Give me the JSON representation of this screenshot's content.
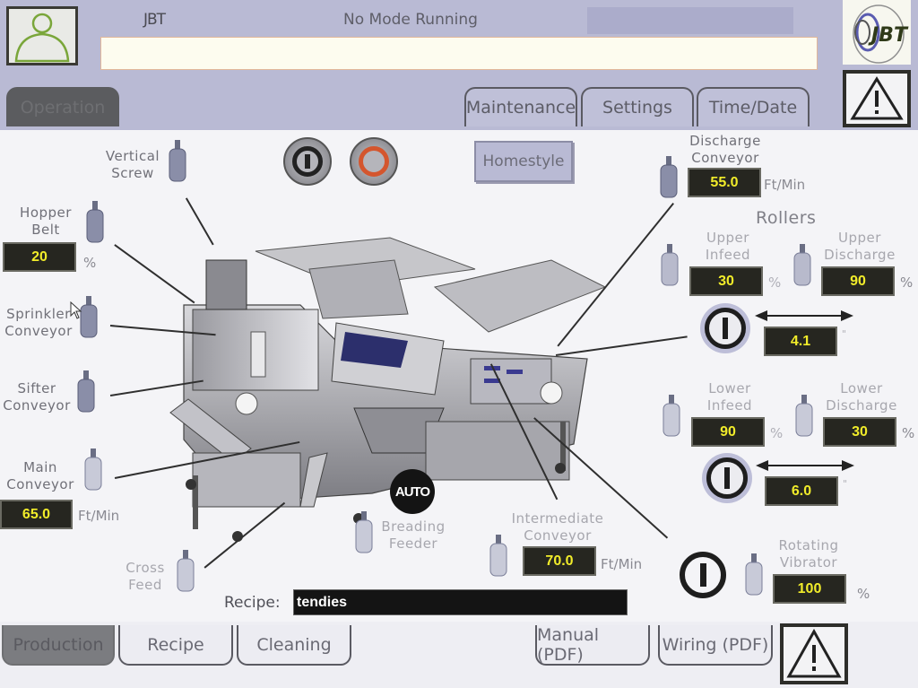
{
  "header": {
    "title": "JBT",
    "mode_status": "No Mode Running",
    "message": "",
    "logo_text": "JBT",
    "tabs": [
      {
        "label": "Operation",
        "active": true
      },
      {
        "label": "Maintenance",
        "active": false
      },
      {
        "label": "Settings",
        "active": false
      },
      {
        "label": "Time/Date",
        "active": false
      }
    ]
  },
  "controls": {
    "start_icon": "power-on-icon",
    "stop_icon": "stop-icon",
    "mode_button": "Homestyle",
    "auto_badge": "AUTO"
  },
  "components": {
    "vertical_screw": {
      "label_1": "Vertical",
      "label_2": "Screw"
    },
    "hopper_belt": {
      "label_1": "Hopper",
      "label_2": "Belt",
      "value": "20",
      "unit": "%"
    },
    "sprinkler_conveyor": {
      "label_1": "Sprinkler",
      "label_2": "Conveyor"
    },
    "sifter_conveyor": {
      "label_1": "Sifter",
      "label_2": "Conveyor"
    },
    "main_conveyor": {
      "label_1": "Main",
      "label_2": "Conveyor",
      "value": "65.0",
      "unit": "Ft/Min"
    },
    "cross_feed": {
      "label_1": "Cross",
      "label_2": "Feed"
    },
    "breading_feeder": {
      "label_1": "Breading",
      "label_2": "Feeder"
    },
    "intermediate_conveyor": {
      "label_1": "Intermediate",
      "label_2": "Conveyor",
      "value": "70.0",
      "unit": "Ft/Min"
    },
    "discharge_conveyor": {
      "label_1": "Discharge",
      "label_2": "Conveyor",
      "value": "55.0",
      "unit": "Ft/Min"
    },
    "rotating_vibrator": {
      "label_1": "Rotating",
      "label_2": "Vibrator",
      "value": "100",
      "unit": "%"
    }
  },
  "rollers": {
    "title": "Rollers",
    "upper_infeed": {
      "label_1": "Upper",
      "label_2": "Infeed",
      "value": "30",
      "unit": "%"
    },
    "upper_discharge": {
      "label_1": "Upper",
      "label_2": "Discharge",
      "value": "90",
      "unit": "%"
    },
    "upper_gap": {
      "value": "4.1",
      "unit": "\""
    },
    "lower_infeed": {
      "label_1": "Lower",
      "label_2": "Infeed",
      "value": "90",
      "unit": "%"
    },
    "lower_discharge": {
      "label_1": "Lower",
      "label_2": "Discharge",
      "value": "30",
      "unit": "%"
    },
    "lower_gap": {
      "value": "6.0",
      "unit": "\""
    }
  },
  "recipe": {
    "label": "Recipe:",
    "value": "tendies"
  },
  "footer": {
    "tabs": [
      {
        "label": "Production",
        "active": true
      },
      {
        "label": "Recipe",
        "active": false
      },
      {
        "label": "Cleaning",
        "active": false
      }
    ],
    "docs": [
      {
        "label": "Manual (PDF)"
      },
      {
        "label": "Wiring (PDF)"
      }
    ]
  },
  "colors": {
    "header_bg": "#b9bad4",
    "value_text": "#f1ec2a",
    "value_bg": "#262620",
    "active_tab": "#5b5c5f",
    "stop_ring": "#d4562e",
    "user_icon": "#7aa63a"
  }
}
